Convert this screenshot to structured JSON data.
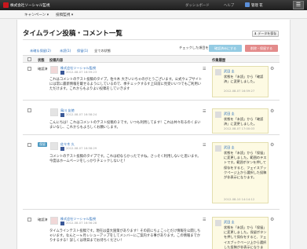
{
  "topbar": {
    "company": "株式会社ソーシャル監視",
    "nav": [
      "ダッシュボード",
      "ヘルプ"
    ],
    "user": "管理 花"
  },
  "subnav": {
    "items": [
      "キャンペーン ▾",
      "投稿監視 ▾"
    ]
  },
  "page": {
    "title": "タイムライン投稿・コメント一覧",
    "save_label": "データを保存",
    "filters": [
      "未確＆保留(2)",
      "未読(1)",
      "保留(1)",
      "全ての状態"
    ],
    "checked_label": "チェックした項目をすべて",
    "confirm_label": "確認済みにする",
    "delete_label": "削除・保留する",
    "columns": {
      "state": "状態",
      "content": "投稿内容",
      "history": "作業履歴"
    }
  },
  "rows": [
    {
      "status": "確認済",
      "poster": "株式会社ソーシャル監視",
      "timestamp": "2012-08-07 16:59:23",
      "body": "これはコメントのテスト投稿のタイプ。佐々木 大きいいちゃのがとうございます。公式ウェブサイトには常に最新情報を載せるようにしているので、季チェックするす上日前に見受いいつでもご利用いただけます。これからもよりよい投稿をしていきます",
      "history": {
        "name": "武田 圭",
        "text": "状態を「未読」から「確認済」に変更しました。",
        "time": "2012-08-07 16:59:27"
      }
    },
    {
      "status": "",
      "poster": "鳥川 友徳",
      "timestamp": "2012-08-07 16:58:24",
      "body": "こんにちは！これはコメントのテスト投稿の２です。いつも利用してます！これは共々有るのくまいまいなし、これからもよろしくお願いします。",
      "history": {
        "name": "武田 圭",
        "text": "状態を「未読」から「確認済」に変更しました。",
        "time": "2012-08-07 17:00:03"
      }
    },
    {
      "status": "保留",
      "poster": "佐々木 久",
      "timestamp": "2012-08-07 16:58:29",
      "body": "コメントのテスト投稿のタイプです。これは初ならかったですね。さっそく利用しないと思います。今度はホームページをしっかりチェックしないと！",
      "history": {
        "name": "武田 圭",
        "text": "状態を「未読」から「保留」に変更しました。範囲のテストです。範囲ボタンを押して保存をすると、フェイスブックページ上から選択した投稿が非表示になります。",
        "time": "2012-08-10 14:14:12"
      }
    },
    {
      "status": "確認済",
      "poster": "株式会社ソーシャル監視",
      "timestamp": "2012-08-07 16:56:28",
      "body": "タイムラインテスト投稿です。現在は盛大施策があります！その前にちょこっとだけ情報を公開しちゃいます。なんと一ヶ月レシューアップをしてメンバーにご案内する事があります。この情報までかりするする！詳しくは明日までお待ちください！",
      "history": {
        "name": "武田 圭",
        "text": "状態を「未読」から「保留」に変更しました。保留ボタンを押して保存をすると、フェイスブックページ上から選択した投稿が非表示になります。",
        "time": ""
      }
    }
  ]
}
